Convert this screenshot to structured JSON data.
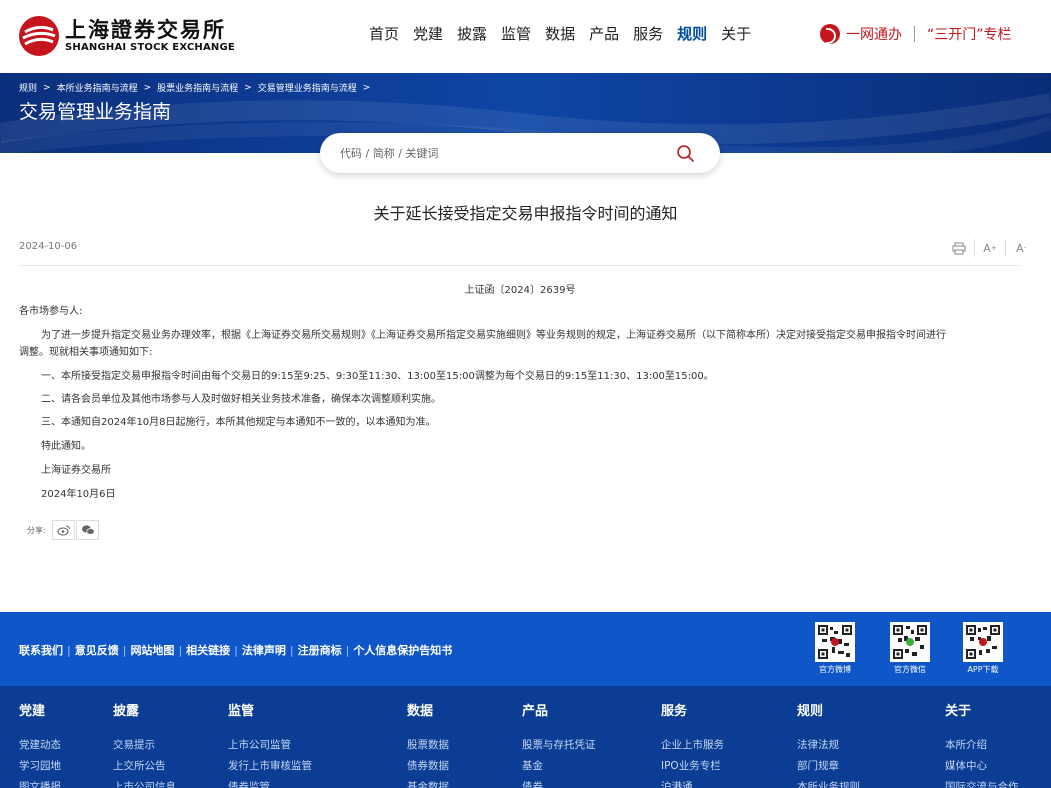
{
  "header": {
    "logo_cn": "上海證券交易所",
    "logo_en": "SHANGHAI STOCK EXCHANGE",
    "nav": [
      {
        "label": "首页",
        "active": false
      },
      {
        "label": "党建",
        "active": false
      },
      {
        "label": "披露",
        "active": false
      },
      {
        "label": "监管",
        "active": false
      },
      {
        "label": "数据",
        "active": false
      },
      {
        "label": "产品",
        "active": false
      },
      {
        "label": "服务",
        "active": false
      },
      {
        "label": "规则",
        "active": true
      },
      {
        "label": "关于",
        "active": false
      }
    ],
    "ywtb_label": "一网通办",
    "sankaimen_label": "“三开门”专栏"
  },
  "banner": {
    "breadcrumb": [
      "规则",
      "本所业务指南与流程",
      "股票业务指南与流程",
      "交易管理业务指南与流程"
    ],
    "title": "交易管理业务指南"
  },
  "search": {
    "placeholder": "代码 / 简称 / 关键词"
  },
  "article": {
    "title": "关于延长接受指定交易申报指令时间的通知",
    "date": "2024-10-06",
    "doc_no": "上证函〔2024〕2639号",
    "salutation": "各市场参与人:",
    "para1_line1": "为了进一步提升指定交易业务办理效率，根据《上海证券交易所交易规则》《上海证券交易所指定交易实施细则》等业务规则的规定，上海证券交易所（以下简称本所）决定对接受指定交易申报指令时间进行",
    "para1_line2": "调整。现就相关事项通知如下:",
    "item1": "一、本所接受指定交易申报指令时间由每个交易日的9:15至9:25、9:30至11:30、13:00至15:00调整为每个交易日的9:15至11:30、13:00至15:00。",
    "item2": "二、请各会员单位及其他市场参与人及时做好相关业务技术准备，确保本次调整顺利实施。",
    "item3": "三、本通知自2024年10月8日起施行，本所其他规定与本通知不一致的，以本通知为准。",
    "closing": "特此通知。",
    "signer": "上海证券交易所",
    "sign_date": "2024年10月6日",
    "share_label": "分享:"
  },
  "footer": {
    "links": [
      "联系我们",
      "意见反馈",
      "网站地图",
      "相关链接",
      "法律声明",
      "注册商标",
      "个人信息保护告知书"
    ],
    "qr_labels": [
      "官方微博",
      "官方微信",
      "APP下载"
    ],
    "columns": [
      {
        "title": "党建",
        "items": [
          "党建动态",
          "学习园地",
          "图文播报"
        ]
      },
      {
        "title": "披露",
        "items": [
          "交易提示",
          "上交所公告",
          "上市公司信息"
        ]
      },
      {
        "title": "监管",
        "items": [
          "上市公司监管",
          "发行上市审核监管",
          "债券监管"
        ]
      },
      {
        "title": "数据",
        "items": [
          "股票数据",
          "债券数据",
          "基金数据"
        ]
      },
      {
        "title": "产品",
        "items": [
          "股票与存托凭证",
          "基金",
          "债券"
        ]
      },
      {
        "title": "服务",
        "items": [
          "企业上市服务",
          "IPO业务专栏",
          "沪港通"
        ]
      },
      {
        "title": "规则",
        "items": [
          "法律法规",
          "部门规章",
          "本所业务规则"
        ]
      },
      {
        "title": "关于",
        "items": [
          "本所介绍",
          "媒体中心",
          "国际交流与合作"
        ]
      }
    ]
  },
  "colors": {
    "brand_red": "#c4161c",
    "nav_active": "#004ea2",
    "banner_blue": "#0f46a6",
    "footer_top": "#0f57c9",
    "footer_bottom": "#0a3d93"
  }
}
